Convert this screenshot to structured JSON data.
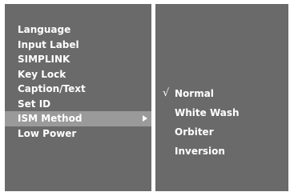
{
  "main_menu": {
    "items": [
      {
        "label": "Language"
      },
      {
        "label": "Input Label"
      },
      {
        "label": "SIMPLINK"
      },
      {
        "label": "Key Lock"
      },
      {
        "label": "Caption/Text"
      },
      {
        "label": "Set ID"
      },
      {
        "label": "ISM Method",
        "selected": true,
        "has_submenu": true
      },
      {
        "label": "Low Power"
      }
    ],
    "submenu_arrow_icon": "right-triangle-arrow"
  },
  "submenu": {
    "check_glyph": "√",
    "items": [
      {
        "label": "Normal",
        "checked": true
      },
      {
        "label": "White Wash"
      },
      {
        "label": "Orbiter"
      },
      {
        "label": "Inversion"
      }
    ]
  },
  "colors": {
    "panel": "#6a6a6a",
    "highlight": "#9a9a9a",
    "text": "#ffffff",
    "divider": "#ffffff"
  }
}
